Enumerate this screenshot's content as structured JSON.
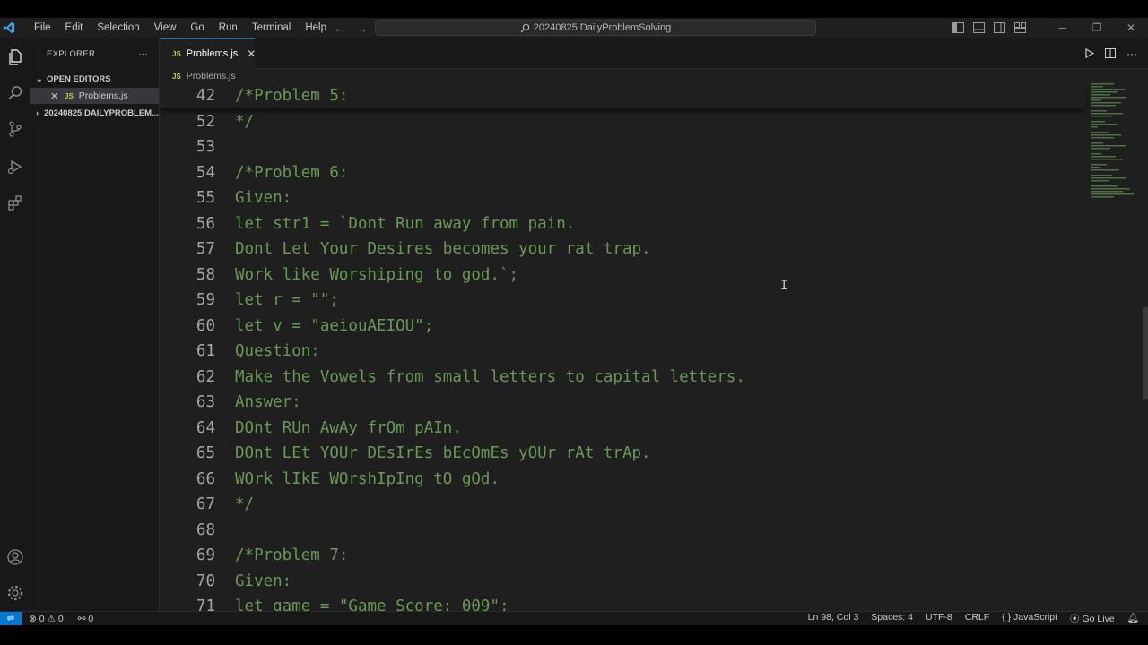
{
  "titlebar": {
    "menu": [
      "File",
      "Edit",
      "Selection",
      "View",
      "Go",
      "Run",
      "Terminal",
      "Help"
    ],
    "search_text": "20240825 DailyProblemSolving"
  },
  "sidebar": {
    "title": "EXPLORER",
    "more": "···",
    "open_editors": "OPEN EDITORS",
    "open_file": "Problems.js",
    "folder": "20240825 DAILYPROBLEM...",
    "js_badge": "JS"
  },
  "tabs": [
    {
      "label": "Problems.js",
      "active": true
    }
  ],
  "breadcrumb": "Problems.js",
  "editor": {
    "sticky": {
      "num": "42",
      "text": "/*Problem 5:"
    },
    "lines": [
      {
        "num": "52",
        "text": "*/"
      },
      {
        "num": "53",
        "text": ""
      },
      {
        "num": "54",
        "text": "/*Problem 6:"
      },
      {
        "num": "55",
        "text": "Given:"
      },
      {
        "num": "56",
        "text": "let str1 = `Dont Run away from pain."
      },
      {
        "num": "57",
        "text": "Dont Let Your Desires becomes your rat trap."
      },
      {
        "num": "58",
        "text": "Work like Worshiping to god.`;"
      },
      {
        "num": "59",
        "text": "let r = \"\";"
      },
      {
        "num": "60",
        "text": "let v = \"aeiouAEIOU\";"
      },
      {
        "num": "61",
        "text": "Question:"
      },
      {
        "num": "62",
        "text": "Make the Vowels from small letters to capital letters."
      },
      {
        "num": "63",
        "text": "Answer:"
      },
      {
        "num": "64",
        "text": "DOnt RUn AwAy frOm pAIn."
      },
      {
        "num": "65",
        "text": "DOnt LEt YOUr DEsIrEs bEcOmEs yOUr rAt trAp."
      },
      {
        "num": "66",
        "text": "WOrk lIkE WOrshIpIng tO gOd."
      },
      {
        "num": "67",
        "text": "*/"
      },
      {
        "num": "68",
        "text": ""
      },
      {
        "num": "69",
        "text": "/*Problem 7:"
      },
      {
        "num": "70",
        "text": "Given:"
      },
      {
        "num": "71",
        "text": "let game = \"Game Score: 009\";"
      }
    ]
  },
  "statusbar": {
    "errors": "0",
    "warnings": "0",
    "ports": "0",
    "position": "Ln 98, Col 3",
    "spaces": "Spaces: 4",
    "encoding": "UTF-8",
    "eol": "CRLF",
    "language": "JavaScript",
    "golive": "Go Live"
  },
  "colors": {
    "accent": "#0078d4",
    "comment": "#6a9955",
    "editor_bg": "#1f1f1f",
    "js_badge": "#cbcb41"
  }
}
